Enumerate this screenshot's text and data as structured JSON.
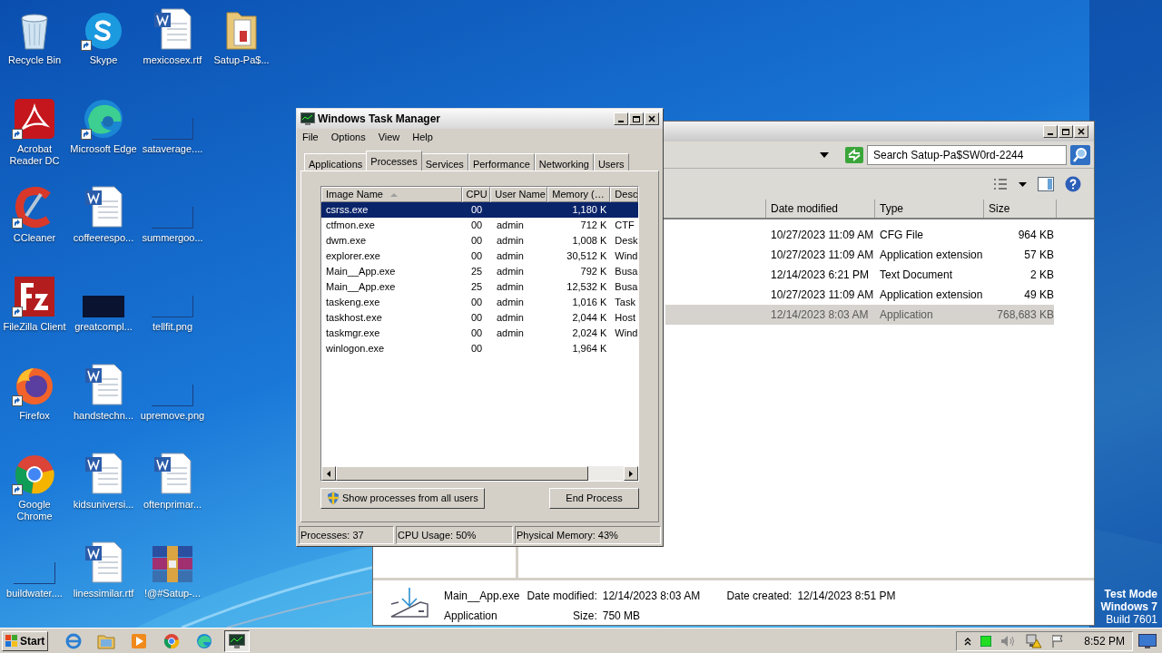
{
  "desktop_rows": [
    [
      {
        "label": "Recycle Bin",
        "kind": "recycle",
        "shortcut": false
      },
      {
        "label": "Skype",
        "kind": "skype",
        "shortcut": true
      },
      {
        "label": "mexicosex.rtf",
        "kind": "word",
        "shortcut": false
      },
      {
        "label": "Satup-Pa$...",
        "kind": "folder",
        "shortcut": false
      }
    ],
    [
      {
        "label": "Acrobat Reader DC",
        "kind": "acrobat",
        "shortcut": true
      },
      {
        "label": "Microsoft Edge",
        "kind": "edge",
        "shortcut": true
      },
      {
        "label": "sataverage....",
        "kind": "blank",
        "shortcut": false
      }
    ],
    [
      {
        "label": "CCleaner",
        "kind": "ccleaner",
        "shortcut": true
      },
      {
        "label": "coffeerespo...",
        "kind": "word",
        "shortcut": false
      },
      {
        "label": "summergoo...",
        "kind": "blank",
        "shortcut": false
      }
    ],
    [
      {
        "label": "FileZilla Client",
        "kind": "filezilla",
        "shortcut": true
      },
      {
        "label": "greatcompl...",
        "kind": "dark",
        "shortcut": false
      },
      {
        "label": "tellfit.png",
        "kind": "blank",
        "shortcut": false
      }
    ],
    [
      {
        "label": "Firefox",
        "kind": "firefox",
        "shortcut": true
      },
      {
        "label": "handstechn...",
        "kind": "word",
        "shortcut": false
      },
      {
        "label": "upremove.png",
        "kind": "blank",
        "shortcut": false
      }
    ],
    [
      {
        "label": "Google Chrome",
        "kind": "chrome",
        "shortcut": true
      },
      {
        "label": "kidsuniversi...",
        "kind": "word",
        "shortcut": false
      },
      {
        "label": "oftenprimar...",
        "kind": "word",
        "shortcut": false
      }
    ],
    [
      {
        "label": "buildwater....",
        "kind": "blank",
        "shortcut": false
      },
      {
        "label": "linessimilar.rtf",
        "kind": "word",
        "shortcut": false
      },
      {
        "label": "!@#Satup-...",
        "kind": "winrar",
        "shortcut": false
      }
    ]
  ],
  "explorer": {
    "search_placeholder": "Search Satup-Pa$SW0rd-2244",
    "columns": [
      "Date modified",
      "Type",
      "Size"
    ],
    "rows": [
      {
        "date": "10/27/2023 11:09 AM",
        "type": "CFG File",
        "size": "964 KB",
        "selected": false
      },
      {
        "date": "10/27/2023 11:09 AM",
        "type": "Application extension",
        "size": "57 KB",
        "selected": false
      },
      {
        "date": "12/14/2023 6:21 PM",
        "type": "Text Document",
        "size": "2 KB",
        "selected": false
      },
      {
        "date": "10/27/2023 11:09 AM",
        "type": "Application extension",
        "size": "49 KB",
        "selected": false
      },
      {
        "date": "12/14/2023 8:03 AM",
        "type": "Application",
        "size": "768,683 KB",
        "selected": true
      }
    ],
    "details": {
      "name": "Main__App.exe",
      "type": "Application",
      "modified_label": "Date modified:",
      "modified": "12/14/2023 8:03 AM",
      "created_label": "Date created:",
      "created": "12/14/2023 8:51 PM",
      "size_label": "Size:",
      "size": "750 MB"
    }
  },
  "task_manager": {
    "title": "Windows Task Manager",
    "menu": [
      "File",
      "Options",
      "View",
      "Help"
    ],
    "tabs": [
      {
        "label": "Applications",
        "selected": false
      },
      {
        "label": "Processes",
        "selected": true
      },
      {
        "label": "Services",
        "selected": false
      },
      {
        "label": "Performance",
        "selected": false
      },
      {
        "label": "Networking",
        "selected": false
      },
      {
        "label": "Users",
        "selected": false
      }
    ],
    "columns": [
      "Image Name",
      "CPU",
      "User Name",
      "Memory (…",
      "Desc"
    ],
    "rows": [
      {
        "name": "csrss.exe",
        "cpu": "00",
        "user": "",
        "memory": "1,180 K",
        "desc": "",
        "selected": true
      },
      {
        "name": "ctfmon.exe",
        "cpu": "00",
        "user": "admin",
        "memory": "712 K",
        "desc": "CTF",
        "selected": false
      },
      {
        "name": "dwm.exe",
        "cpu": "00",
        "user": "admin",
        "memory": "1,008 K",
        "desc": "Desk",
        "selected": false
      },
      {
        "name": "explorer.exe",
        "cpu": "00",
        "user": "admin",
        "memory": "30,512 K",
        "desc": "Wind",
        "selected": false
      },
      {
        "name": "Main__App.exe",
        "cpu": "25",
        "user": "admin",
        "memory": "792 K",
        "desc": "Busa",
        "selected": false
      },
      {
        "name": "Main__App.exe",
        "cpu": "25",
        "user": "admin",
        "memory": "12,532 K",
        "desc": "Busa",
        "selected": false
      },
      {
        "name": "taskeng.exe",
        "cpu": "00",
        "user": "admin",
        "memory": "1,016 K",
        "desc": "Task",
        "selected": false
      },
      {
        "name": "taskhost.exe",
        "cpu": "00",
        "user": "admin",
        "memory": "2,044 K",
        "desc": "Host",
        "selected": false
      },
      {
        "name": "taskmgr.exe",
        "cpu": "00",
        "user": "admin",
        "memory": "2,024 K",
        "desc": "Wind",
        "selected": false
      },
      {
        "name": "winlogon.exe",
        "cpu": "00",
        "user": "",
        "memory": "1,964 K",
        "desc": "",
        "selected": false
      }
    ],
    "show_all_button": "Show processes from all users",
    "end_button": "End Process",
    "status": [
      "Processes: 37",
      "CPU Usage: 50%",
      "Physical Memory: 43%"
    ]
  },
  "watermark": [
    "Test Mode",
    "Windows 7",
    "Build 7601"
  ],
  "taskbar": {
    "start": "Start",
    "apps": [
      {
        "kind": "ie",
        "active": false
      },
      {
        "kind": "explorer",
        "active": false
      },
      {
        "kind": "media",
        "active": false
      },
      {
        "kind": "chrome",
        "active": false
      },
      {
        "kind": "edge",
        "active": false
      },
      {
        "kind": "taskmgr",
        "active": true
      }
    ],
    "clock": "8:52 PM"
  }
}
